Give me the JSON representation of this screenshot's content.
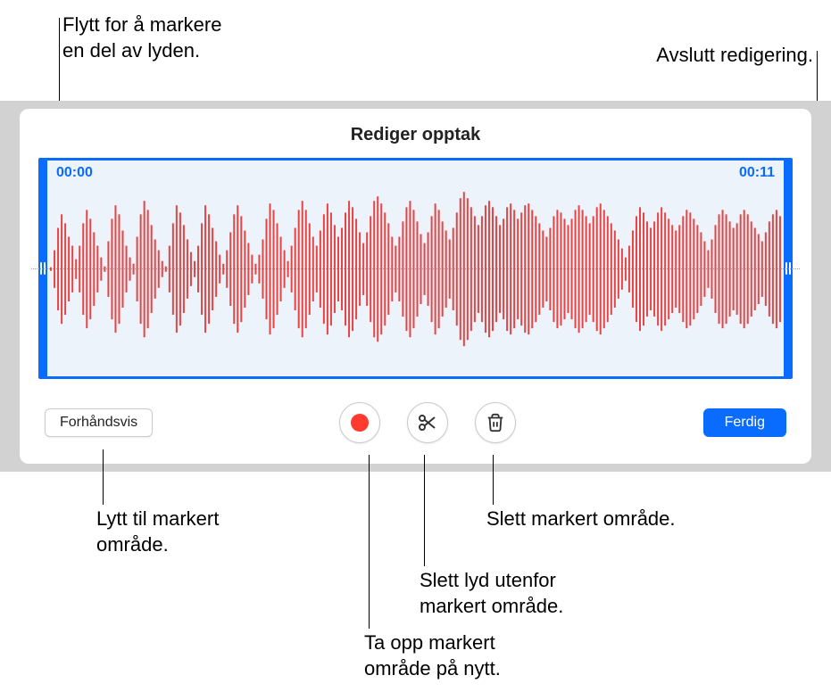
{
  "callouts": {
    "top_left": "Flytt for å markere\nen del av lyden.",
    "top_right": "Avslutt redigering.",
    "preview": "Lytt til markert\nområde.",
    "delete": "Slett markert område.",
    "trim": "Slett lyd utenfor\nmarkert område.",
    "rerecord": "Ta opp markert\nområde på nytt."
  },
  "panel": {
    "title": "Rediger opptak",
    "time_start": "00:00",
    "time_end": "00:11",
    "preview_label": "Forhåndsvis",
    "done_label": "Ferdig"
  }
}
